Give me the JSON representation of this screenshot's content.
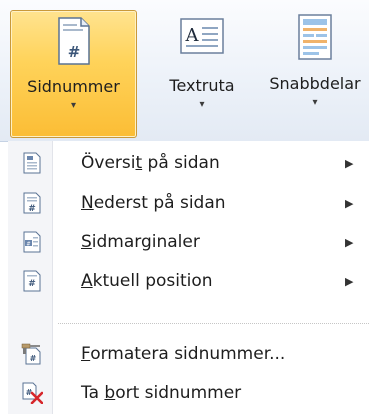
{
  "ribbon": {
    "buttons": [
      {
        "label": "Sidnummer",
        "icon": "page-number-icon",
        "active": true
      },
      {
        "label": "Textruta",
        "icon": "text-box-icon"
      },
      {
        "label": "Snabbdelar",
        "icon": "quick-parts-icon"
      }
    ],
    "dropdown_arrow": "▾"
  },
  "menu": {
    "items": [
      {
        "pre": "Översi",
        "acc": "t",
        "post": " på sidan",
        "submenu": true,
        "icon": "top-of-page-icon"
      },
      {
        "pre": "",
        "acc": "N",
        "post": "ederst på sidan",
        "submenu": true,
        "icon": "bottom-of-page-icon"
      },
      {
        "pre": "",
        "acc": "S",
        "post": "idmarginaler",
        "submenu": true,
        "icon": "page-margins-icon"
      },
      {
        "pre": "",
        "acc": "A",
        "post": "ktuell position",
        "submenu": true,
        "icon": "current-position-icon"
      },
      {
        "pre": "",
        "acc": "F",
        "post": "ormatera sidnummer...",
        "submenu": false,
        "icon": "format-page-numbers-icon"
      },
      {
        "pre": "Ta ",
        "acc": "b",
        "post": "ort sidnummer",
        "submenu": false,
        "icon": "remove-page-numbers-icon"
      }
    ],
    "submenu_arrow": "▶"
  },
  "colors": {
    "active_button": "#ffd35a",
    "ribbon_bg": "#edf2f9",
    "remove_x": "#d6262b"
  }
}
